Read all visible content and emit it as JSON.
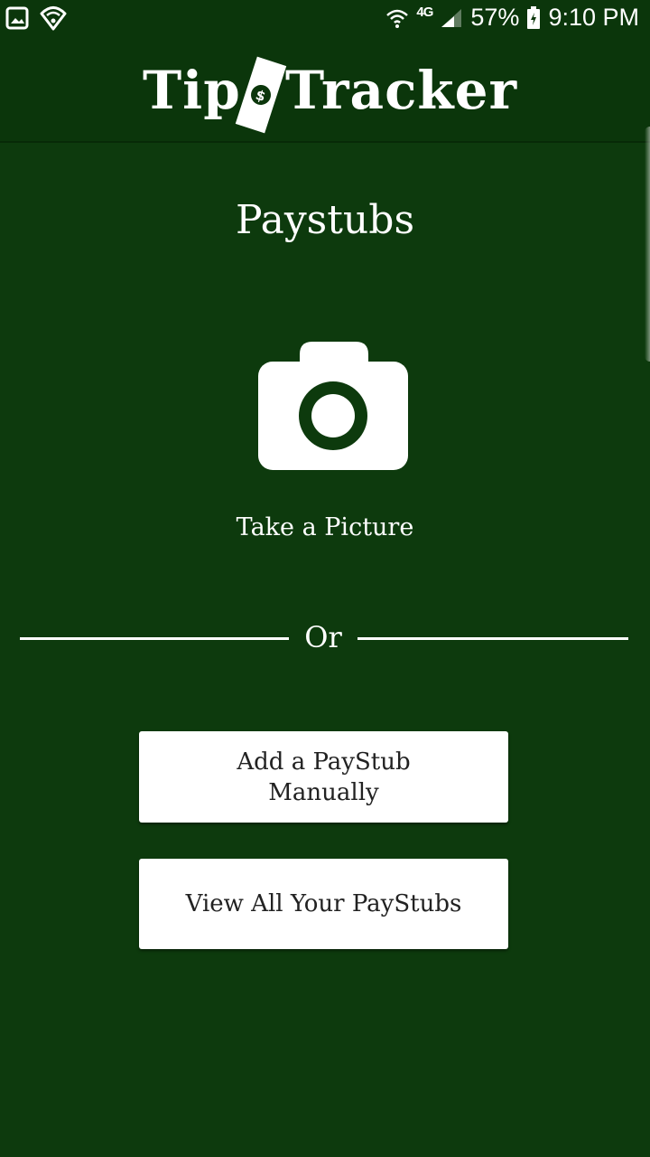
{
  "status_bar": {
    "network_type": "4G",
    "battery_percent": "57%",
    "time": "9:10 PM",
    "icons": [
      "gallery-icon",
      "shield-wifi-icon",
      "wifi-icon",
      "signal-icon",
      "battery-icon"
    ]
  },
  "header": {
    "logo_left": "Tip",
    "logo_right": "Tracker",
    "logo_icon": "money-bill-icon"
  },
  "main": {
    "title": "Paystubs",
    "camera_icon": "camera-icon",
    "camera_label": "Take a Picture",
    "divider_text": "Or",
    "add_button_label": "Add a PayStub Manually",
    "view_button_label": "View All Your PayStubs"
  },
  "colors": {
    "background": "#0d3a0d",
    "header": "#0b360b",
    "button_bg": "#ffffff",
    "button_text": "#222222"
  }
}
